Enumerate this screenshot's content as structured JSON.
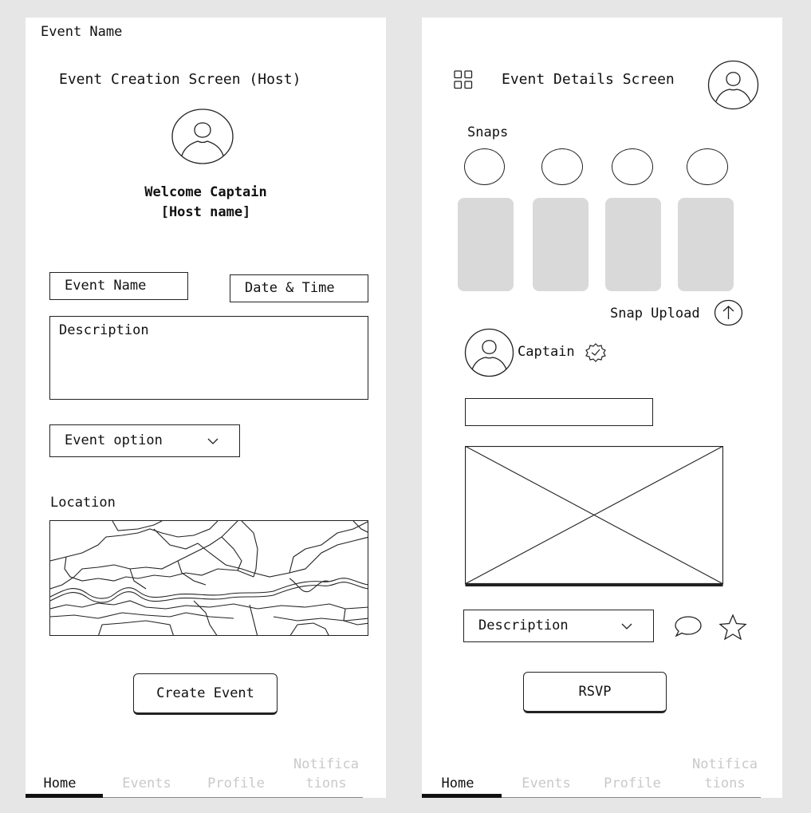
{
  "left": {
    "corner_label": "Event Name",
    "screen_title": "Event Creation Screen (Host)",
    "welcome_line1": "Welcome Captain",
    "welcome_line2": "[Host name]",
    "event_name_field": "Event Name",
    "date_time_field": "Date & Time",
    "description_field": "Description",
    "event_option_select": "Event option",
    "location_label": "Location",
    "create_button": "Create Event",
    "tabs": [
      "Home",
      "Events",
      "Profile",
      "Notifica\ntions"
    ]
  },
  "right": {
    "screen_title": "Event Details Screen",
    "snaps_label": "Snaps",
    "snap_upload_label": "Snap Upload",
    "captain_name": "Captain",
    "description_select": "Description",
    "rsvp_button": "RSVP",
    "tabs": [
      "Home",
      "Events",
      "Profile",
      "Notifica\ntions"
    ]
  },
  "icons": {
    "avatar": "avatar-icon",
    "grid": "grid-icon",
    "upload": "upload-arrow-icon",
    "verified": "verified-badge-icon",
    "chevron": "chevron-down-icon",
    "comment": "comment-bubble-icon",
    "star": "star-icon"
  },
  "colors": {
    "background": "#e6e6e6",
    "screen": "#ffffff",
    "placeholder_card": "#d9d9d9",
    "inactive_tab": "#c9c9c9",
    "ink": "#111111"
  }
}
